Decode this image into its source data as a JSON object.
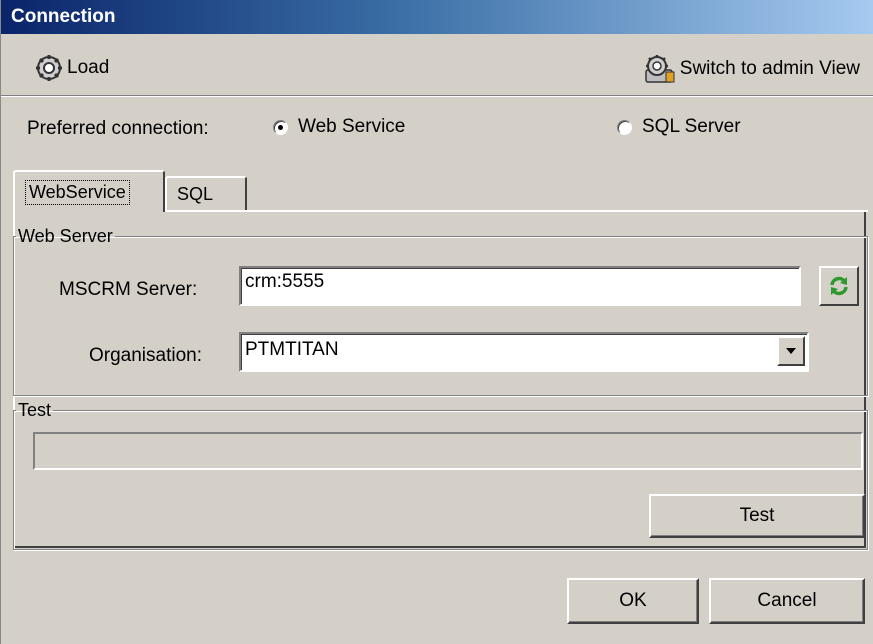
{
  "window": {
    "title": "Connection"
  },
  "toolbar": {
    "load_label": "Load",
    "load_icon": "gear-icon",
    "admin_label": "Switch to admin View",
    "admin_icon": "admin-gear-icon"
  },
  "preferred": {
    "label": "Preferred connection:",
    "options": [
      {
        "label": "Web Service",
        "selected": true
      },
      {
        "label": "SQL Server",
        "selected": false
      }
    ]
  },
  "tabs": [
    {
      "label": "WebService",
      "active": true
    },
    {
      "label": "SQL",
      "active": false
    }
  ],
  "web_server": {
    "legend": "Web Server",
    "server_label": "MSCRM Server:",
    "server_value": "crm:5555",
    "refresh_icon": "refresh-icon",
    "org_label": "Organisation:",
    "org_value": "PTMTITAN"
  },
  "test": {
    "legend": "Test",
    "progress": 0,
    "button_label": "Test"
  },
  "footer": {
    "ok_label": "OK",
    "cancel_label": "Cancel"
  },
  "colors": {
    "title_start": "#0a246a",
    "title_end": "#a6caf0",
    "face": "#d4d0c8",
    "refresh_green": "#2e9a2e"
  }
}
